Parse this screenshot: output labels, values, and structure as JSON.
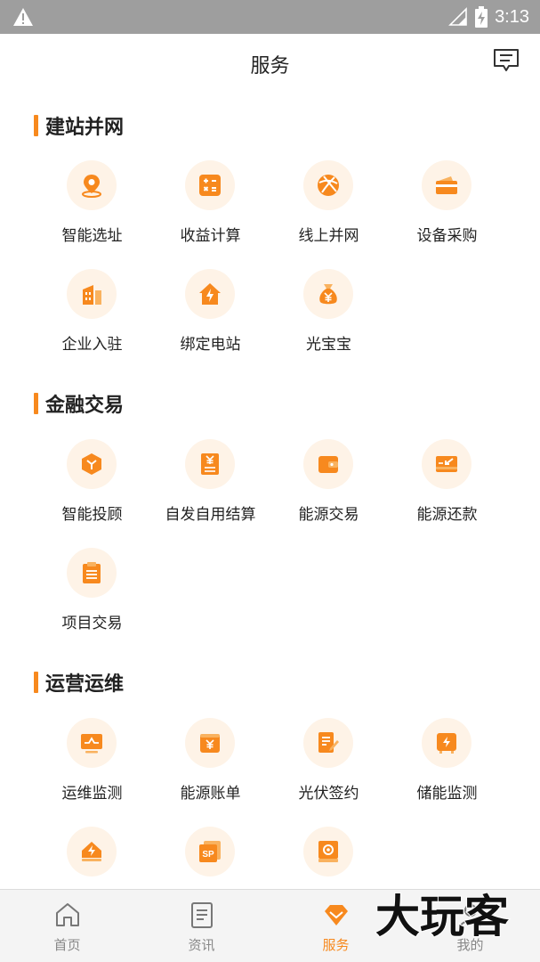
{
  "status_bar": {
    "time": "3:13"
  },
  "header": {
    "title": "服务"
  },
  "sections": [
    {
      "title": "建站并网",
      "items": [
        {
          "label": "智能选址",
          "icon": "location-pin-icon"
        },
        {
          "label": "收益计算",
          "icon": "calculator-icon"
        },
        {
          "label": "线上并网",
          "icon": "grid-globe-icon"
        },
        {
          "label": "设备采购",
          "icon": "card-icon"
        },
        {
          "label": "企业入驻",
          "icon": "building-icon"
        },
        {
          "label": "绑定电站",
          "icon": "power-station-icon"
        },
        {
          "label": "光宝宝",
          "icon": "money-bag-icon"
        }
      ]
    },
    {
      "title": "金融交易",
      "items": [
        {
          "label": "智能投顾",
          "icon": "cube-icon"
        },
        {
          "label": "自发自用结算",
          "icon": "yen-bill-icon"
        },
        {
          "label": "能源交易",
          "icon": "wallet-icon"
        },
        {
          "label": "能源还款",
          "icon": "repay-card-icon"
        },
        {
          "label": "项目交易",
          "icon": "clipboard-icon"
        }
      ]
    },
    {
      "title": "运营运维",
      "items": [
        {
          "label": "运维监测",
          "icon": "monitor-icon"
        },
        {
          "label": "能源账单",
          "icon": "bill-icon"
        },
        {
          "label": "光伏签约",
          "icon": "sign-document-icon"
        },
        {
          "label": "储能监测",
          "icon": "battery-cabinet-icon"
        },
        {
          "label": "",
          "icon": "energy-house-icon"
        },
        {
          "label": "",
          "icon": "sp-icon"
        },
        {
          "label": "",
          "icon": "settings-box-icon"
        }
      ]
    }
  ],
  "tabbar": [
    {
      "label": "首页",
      "icon": "home-icon",
      "active": false
    },
    {
      "label": "资讯",
      "icon": "news-icon",
      "active": false
    },
    {
      "label": "服务",
      "icon": "service-diamond-icon",
      "active": true
    },
    {
      "label": "我的",
      "icon": "profile-icon",
      "active": false
    }
  ],
  "watermark": {
    "text": "大玩客"
  },
  "colors": {
    "accent": "#f7891e",
    "icon_bg": "#fef3e7",
    "status_bar": "#9e9e9e",
    "tab_bg": "#f4f4f4"
  }
}
